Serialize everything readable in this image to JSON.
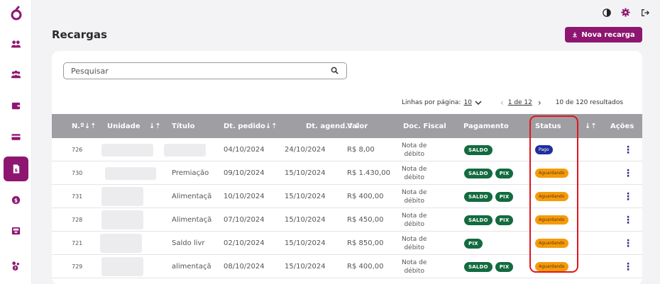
{
  "sidebar": {
    "logo_icon": "brand-logo-icon",
    "items": [
      {
        "name": "users-icon"
      },
      {
        "name": "groups-icon"
      },
      {
        "name": "wallet-icon"
      },
      {
        "name": "card-icon"
      },
      {
        "name": "recharges-icon",
        "active": true
      },
      {
        "name": "coin-icon"
      },
      {
        "name": "store-icon"
      },
      {
        "name": "settings-group-icon"
      }
    ]
  },
  "top_actions": [
    "contrast-icon",
    "gear-icon",
    "logout-icon"
  ],
  "page": {
    "title": "Recargas",
    "new_button": "Nova recarga"
  },
  "search": {
    "placeholder": "Pesquisar"
  },
  "pager": {
    "rows_label": "Linhas por página:",
    "rows_value": "10",
    "page": "1 de 12",
    "results": "10 de 120 resultados"
  },
  "table": {
    "headers": {
      "id": "N.º",
      "unit": "Unidade",
      "title": "Título",
      "order_date": "Dt. pedido",
      "sched_date": "Dt. agend.",
      "value": "Valor",
      "doc": "Doc. Fiscal",
      "payment": "Pagamento",
      "status": "Status",
      "actions": "Ações"
    },
    "rows": [
      {
        "id": "726",
        "title": "",
        "order_date": "04/10/2024",
        "sched_date": "24/10/2024",
        "value": "R$ 8,00",
        "doc1": "Nota de",
        "doc2": "débito",
        "payment": [
          "SALDO"
        ],
        "status": "Pago",
        "status_type": "paid"
      },
      {
        "id": "730",
        "title": "Premiação",
        "order_date": "09/10/2024",
        "sched_date": "15/10/2024",
        "value": "R$ 1.430,00",
        "doc1": "Nota de",
        "doc2": "débito",
        "payment": [
          "SALDO",
          "PIX"
        ],
        "status": "Aguardando",
        "status_type": "pending"
      },
      {
        "id": "731",
        "title": "Alimentaçã",
        "order_date": "10/10/2024",
        "sched_date": "15/10/2024",
        "value": "R$ 400,00",
        "doc1": "Nota de",
        "doc2": "débito",
        "payment": [
          "SALDO",
          "PIX"
        ],
        "status": "Aguardando",
        "status_type": "pending"
      },
      {
        "id": "728",
        "title": "Alimentaçã",
        "order_date": "07/10/2024",
        "sched_date": "15/10/2024",
        "value": "R$ 450,00",
        "doc1": "Nota de",
        "doc2": "débito",
        "payment": [
          "SALDO",
          "PIX"
        ],
        "status": "Aguardando",
        "status_type": "pending"
      },
      {
        "id": "721",
        "title": "Saldo livr",
        "order_date": "02/10/2024",
        "sched_date": "15/10/2024",
        "value": "R$ 850,00",
        "doc1": "Nota de",
        "doc2": "débito",
        "payment": [
          "PIX"
        ],
        "status": "Aguardando",
        "status_type": "pending"
      },
      {
        "id": "729",
        "title": "alimentaçã",
        "order_date": "08/10/2024",
        "sched_date": "15/10/2024",
        "value": "R$ 400,00",
        "doc1": "Nota de",
        "doc2": "débito",
        "payment": [
          "SALDO",
          "PIX"
        ],
        "status": "Aguardando",
        "status_type": "pending"
      }
    ]
  },
  "colors": {
    "brand": "#8e1670",
    "header_bg": "#9e9ea3",
    "chip_green": "#136b3f",
    "status_paid": "#1f2f9e",
    "status_pending": "#f59a0c",
    "highlight": "#e0151e"
  }
}
